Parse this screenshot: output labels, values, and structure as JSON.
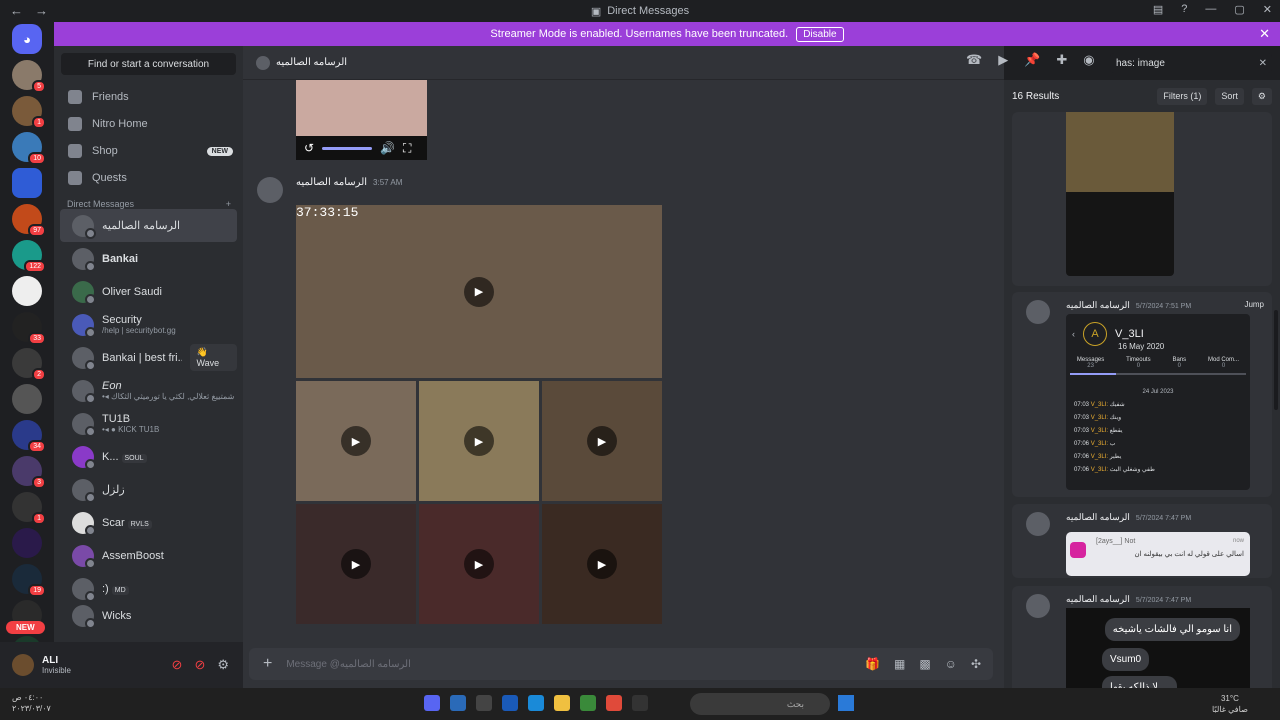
{
  "window": {
    "title": "Direct Messages"
  },
  "banner": {
    "text": "Streamer Mode is enabled. Usernames have been truncated.",
    "button": "Disable"
  },
  "guilds": {
    "badges": [
      "5",
      "1",
      "10",
      "",
      "97",
      "122",
      "",
      "33",
      "2",
      "",
      "34",
      "3",
      "1",
      "",
      "19",
      "",
      "1"
    ],
    "new_pill": "NEW"
  },
  "sidebar": {
    "search_placeholder": "Find or start a conversation",
    "nav": [
      {
        "label": "Friends",
        "icon": "friends-icon"
      },
      {
        "label": "Nitro Home",
        "icon": "nitro-icon"
      },
      {
        "label": "Shop",
        "icon": "shop-icon",
        "tag": "NEW"
      },
      {
        "label": "Quests",
        "icon": "quests-icon"
      }
    ],
    "dm_header": "Direct Messages",
    "dm_add": "+",
    "dms": [
      {
        "name": "الرسامه الصالميه",
        "sub": ""
      },
      {
        "name": "Bankai",
        "sub": ""
      },
      {
        "name": "Oliver Saudi",
        "sub": ""
      },
      {
        "name": "Security",
        "sub": "/help | securitybot.gg"
      },
      {
        "name": "Bankai | best fri...",
        "sub": "",
        "wave": "👋 Wave"
      },
      {
        "name": "Eon",
        "sub": "•◂ الوستيي الي شمتييغ ثعلالي, لكثي يا تورميثي الثكاك"
      },
      {
        "name": "TU1B",
        "sub": "•◂ ● KICK TU1B"
      },
      {
        "name": "K...",
        "sub": "",
        "tag": "SOUL"
      },
      {
        "name": "زلزل",
        "sub": ""
      },
      {
        "name": "Scar",
        "sub": "",
        "tag": "RVLS"
      },
      {
        "name": "AssemBoost",
        "sub": ""
      },
      {
        "name": ":)",
        "sub": "",
        "tag": "MD"
      },
      {
        "name": "Wicks",
        "sub": ""
      }
    ]
  },
  "user": {
    "name": "ALI",
    "status": "Invisible"
  },
  "chat": {
    "channel_name": "الرسامه الصالميه",
    "message": {
      "author": "الرسامه الصالميه",
      "time": "3:57 AM",
      "video_timestamp": "37:33:15"
    },
    "composer_placeholder": "Message @الرسامه الصالميه"
  },
  "search": {
    "query": "has: image",
    "results_count": "16 Results",
    "filters_label": "Filters (1)",
    "sort_label": "Sort",
    "results": [
      {
        "author": "",
        "time": ""
      },
      {
        "author": "الرسامه الصالميه",
        "time": "5/7/2024 7:51 PM",
        "jump": "Jump",
        "panel": {
          "username": "V_3LI",
          "joined": "16 May 2020",
          "stats": [
            {
              "label": "Messages",
              "value": "23"
            },
            {
              "label": "Timeouts",
              "value": "0"
            },
            {
              "label": "Bans",
              "value": "0"
            },
            {
              "label": "Mod Com...",
              "value": "0"
            }
          ],
          "day": "24 Jul 2023",
          "rows": [
            {
              "time": "07:03",
              "user": "V_3LI:",
              "text": "شفيك"
            },
            {
              "time": "07:03",
              "user": "V_3LI:",
              "text": "وينك"
            },
            {
              "time": "07:03",
              "user": "V_3LI:",
              "text": "يقطع"
            },
            {
              "time": "07:06",
              "user": "V_3LI:",
              "text": "ب"
            },
            {
              "time": "07:06",
              "user": "V_3LI:",
              "text": "يطير"
            },
            {
              "time": "07:06",
              "user": "V_3LI:",
              "text": "طفي وشغلي البث"
            }
          ]
        }
      },
      {
        "author": "الرسامه الصالميه",
        "time": "5/7/2024 7:47 PM",
        "notification": {
          "app": "[2ays__] Not",
          "when": "now",
          "body": "اسالي على قولي له انت بي بيقولنه ان"
        }
      },
      {
        "author": "الرسامه الصالميه",
        "time": "5/7/2024 7:47 PM",
        "bubbles": [
          "انا سومو الي فالشات ياشيخه",
          "Vsum0",
          "لا ذالكه بقها ... "
        ]
      }
    ]
  },
  "taskbar": {
    "time": "٠٤:٠٠ ص",
    "date": "٢٠٢٣/٠٣/٠٧",
    "search": "بحث",
    "weather": "31°C",
    "weather_desc": "صافي غالبًا"
  },
  "colors": {
    "accent": "#5865f2",
    "banner": "#9b3fd9",
    "danger": "#f23f43"
  }
}
